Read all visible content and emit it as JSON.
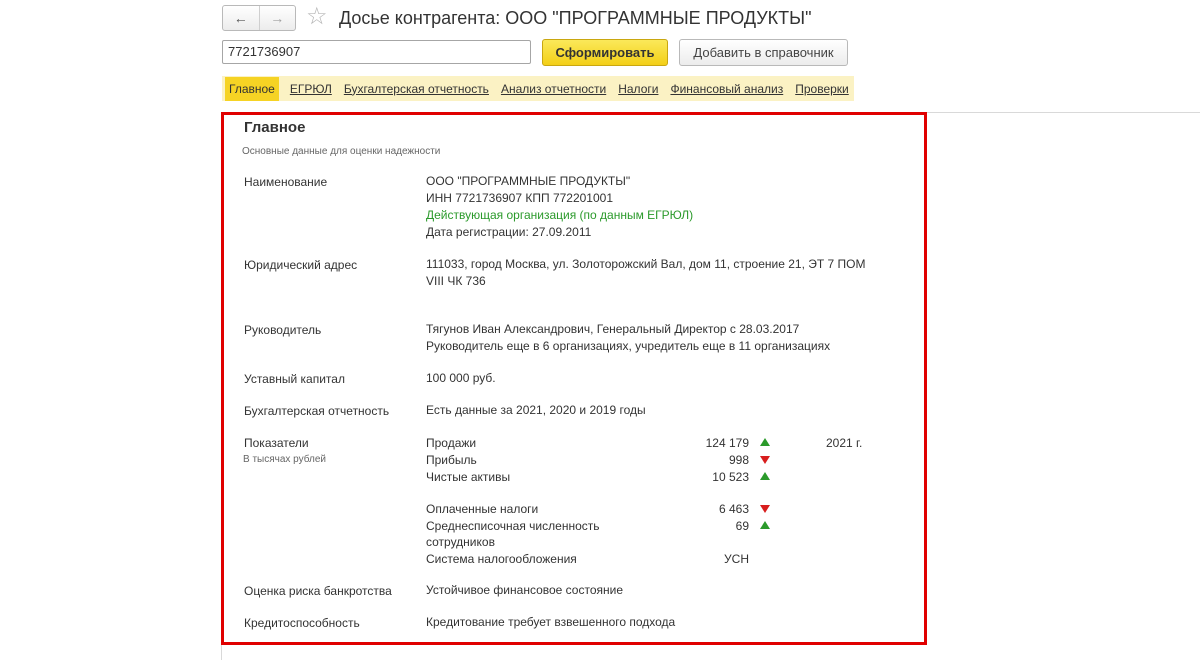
{
  "header": {
    "back_icon": "arrow-left-icon",
    "forward_icon": "arrow-right-icon",
    "favorite_icon": "star-icon",
    "title": "Досье контрагента: ООО \"ПРОГРАММНЫЕ ПРОДУКТЫ\""
  },
  "search": {
    "value": "7721736907",
    "generate_label": "Сформировать",
    "add_label": "Добавить в справочник"
  },
  "tabs": [
    {
      "label": "Главное",
      "active": true
    },
    {
      "label": "ЕГРЮЛ"
    },
    {
      "label": "Бухгалтерская отчетность"
    },
    {
      "label": "Анализ отчетности"
    },
    {
      "label": "Налоги"
    },
    {
      "label": "Финансовый анализ"
    },
    {
      "label": "Проверки"
    }
  ],
  "main": {
    "heading": "Главное",
    "subheading": "Основные данные для оценки надежности",
    "name_label": "Наименование",
    "name_lines": [
      "ООО \"ПРОГРАММНЫЕ ПРОДУКТЫ\"",
      "ИНН 7721736907 КПП 772201001",
      "Действующая организация (по данным ЕГРЮЛ)",
      "Дата регистрации: 27.09.2011"
    ],
    "address_label": "Юридический адрес",
    "address_lines": [
      "111033, город Москва, ул. Золоторожский Вал, дом 11, строение 21, ЭТ 7 ПОМ",
      "VIII ЧК 736"
    ],
    "director_label": "Руководитель",
    "director_lines": [
      "Тягунов Иван Александрович, Генеральный Директор с 28.03.2017",
      "Руководитель еще в 6 организациях, учредитель еще в 11 организациях"
    ],
    "capital_label": "Уставный капитал",
    "capital_value": "100 000 руб.",
    "reporting_label": "Бухгалтерская отчетность",
    "reporting_value": "Есть данные за 2021, 2020 и 2019 годы",
    "indicators_label": "Показатели",
    "indicators_note": "В тысячах рублей",
    "indicators_year": "2021 г.",
    "indicators": [
      {
        "name": "Продажи",
        "value": "124 179",
        "trend": "up"
      },
      {
        "name": "Прибыль",
        "value": "998",
        "trend": "down"
      },
      {
        "name": "Чистые активы",
        "value": "10 523",
        "trend": "up"
      },
      {
        "name": "Оплаченные налоги",
        "value": "6 463",
        "trend": "down"
      },
      {
        "name": "Среднесписочная численность",
        "name2": "сотрудников",
        "value": "69",
        "trend": "up"
      },
      {
        "name": "Система налогообложения",
        "value": "УСН",
        "trend": "none"
      }
    ],
    "risk_label": "Оценка риска банкротства",
    "risk_value": "Устойчивое финансовое состояние",
    "credit_label": "Кредитоспособность",
    "credit_value": "Кредитование требует взвешенного подхода"
  }
}
